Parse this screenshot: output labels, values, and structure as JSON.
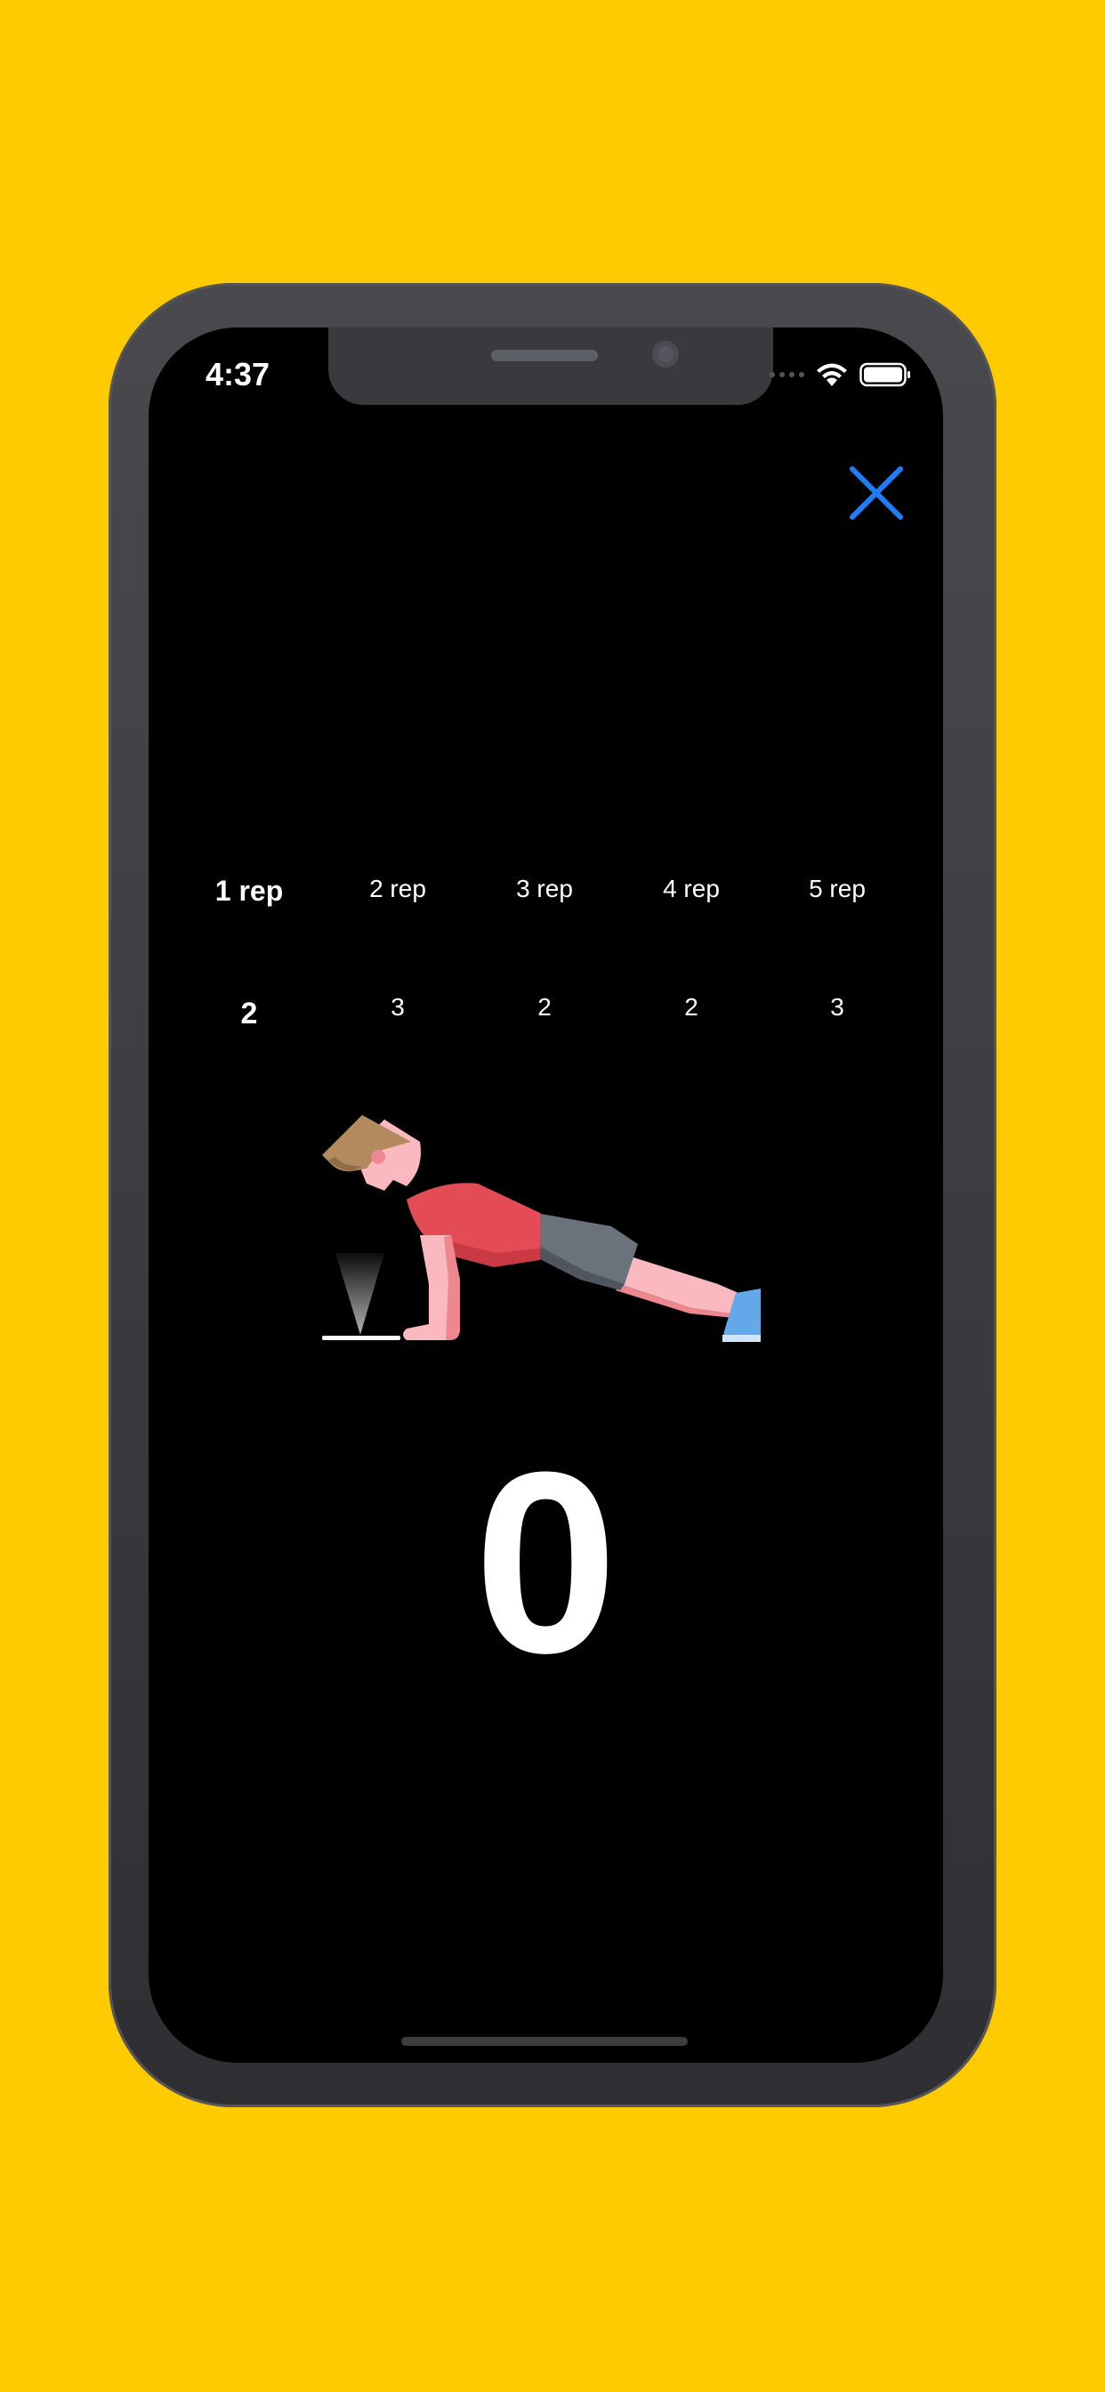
{
  "status_bar": {
    "time": "4:37"
  },
  "close_icon": "close-icon",
  "accent_color": "#1E7DF7",
  "background_color": "#FDCB00",
  "workout": {
    "tabs": [
      {
        "label": "1 rep",
        "active": true
      },
      {
        "label": "2 rep",
        "active": false
      },
      {
        "label": "3 rep",
        "active": false
      },
      {
        "label": "4 rep",
        "active": false
      },
      {
        "label": "5 rep",
        "active": false
      }
    ],
    "counts": [
      "2",
      "3",
      "2",
      "2",
      "3"
    ],
    "current_count": "0",
    "illustration": "pushup-person-illustration"
  }
}
